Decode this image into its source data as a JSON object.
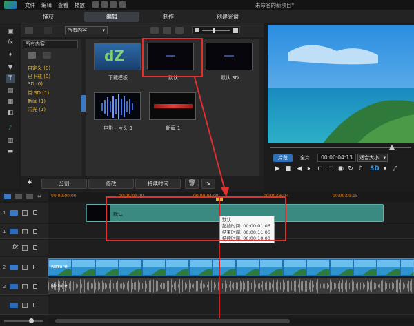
{
  "menu": [
    "文件",
    "编辑",
    "查看",
    "播放"
  ],
  "window_title": "未命名的新项目*",
  "tabs": [
    {
      "label": "捕获",
      "active": false
    },
    {
      "label": "编辑",
      "active": true
    },
    {
      "label": "制作",
      "active": false
    },
    {
      "label": "创建光盘",
      "active": false
    }
  ],
  "library": {
    "dropdown_value": "所有内容",
    "category_header": "所有内容",
    "categories": [
      "自定义 (0)",
      "已下载 (0)",
      "3D (0)",
      "类 3D (1)",
      "新闻 (1)",
      "闪光 (1)"
    ],
    "items": [
      {
        "label": "下载模板",
        "thumb_text": "dZ"
      },
      {
        "label": "默认",
        "thumb_text": ""
      },
      {
        "label": "默认 3D",
        "thumb_text": ""
      },
      {
        "label": "电影 - 片头 3",
        "thumb_text": ""
      },
      {
        "label": "新闻 1",
        "thumb_text": ""
      }
    ]
  },
  "bottom_buttons": [
    "分割",
    "修改",
    "持续时间"
  ],
  "player": {
    "mode_clip": "片段",
    "mode_full": "全片",
    "timecode": "00:00:04:13",
    "fit": "适合大小",
    "threed": "3D"
  },
  "ruler_ticks": [
    "00:00:00:00",
    "00:00:01:20",
    "00:00:04:08",
    "00:00:06:24",
    "00:00:09:15"
  ],
  "tracks": {
    "title_track_num": "1",
    "voice_track_num": "1",
    "video_track_num": "2",
    "audio_track_num": "2"
  },
  "timeline": {
    "title_clip_label": "默认",
    "video_clip_label": "Nature",
    "audio_clip_label": "Nature",
    "tooltip": {
      "name": "默认",
      "start": "起始时间: 00:00:01:06",
      "end": "结束时间: 00:00:11:06",
      "duration": "持续时间: 00:00:10:00"
    }
  },
  "colors": {
    "accent": "#3a78c8",
    "highlight": "#e03030",
    "category_text": "#e2b43f",
    "clip": "#3a8a82"
  }
}
